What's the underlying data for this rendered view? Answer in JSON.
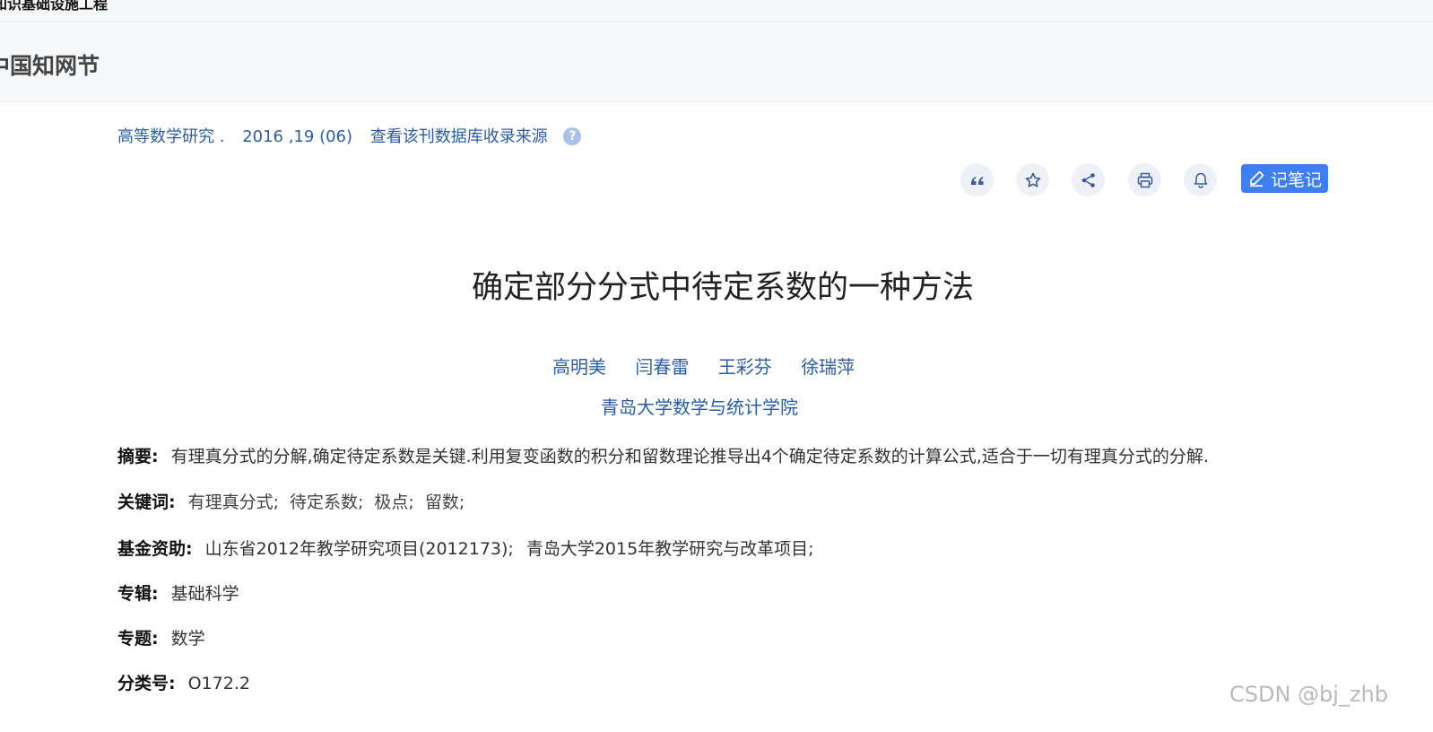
{
  "topbar": {
    "title": "知识基础设施工程"
  },
  "header": {
    "title": "中国知网节"
  },
  "source": {
    "journal": "高等数学研究 .",
    "issue": "2016 ,19 (06)",
    "db_link": "查看该刊数据库收录来源",
    "help_icon": "?"
  },
  "toolbar": {
    "note_label": "记笔记",
    "icons": [
      "quote-icon",
      "star-icon",
      "share-icon",
      "print-icon",
      "bell-icon"
    ]
  },
  "article": {
    "title": "确定部分分式中待定系数的一种方法",
    "authors": [
      "高明美",
      "闫春雷",
      "王彩芬",
      "徐瑞萍"
    ],
    "affiliation": "青岛大学数学与统计学院"
  },
  "meta": {
    "abstract_label": "摘要:",
    "abstract": "有理真分式的分解,确定待定系数是关键.利用复变函数的积分和留数理论推导出4个确定待定系数的计算公式,适合于一切有理真分式的分解.",
    "keywords_label": "关键词:",
    "keywords": [
      "有理真分式;",
      "待定系数;",
      "极点;",
      "留数;"
    ],
    "fund_label": "基金资助:",
    "funds": [
      "山东省2012年教学研究项目(2012173);",
      "青岛大学2015年教学研究与改革项目;"
    ],
    "album_label": "专辑:",
    "album": "基础科学",
    "topic_label": "专题:",
    "topic": "数学",
    "class_label": "分类号:",
    "class_no": "O172.2"
  },
  "watermark": "CSDN @bj_zhb",
  "colors": {
    "link": "#2a5ea8",
    "accent": "#3d7ff2",
    "icon_bg": "#eef1f7"
  }
}
